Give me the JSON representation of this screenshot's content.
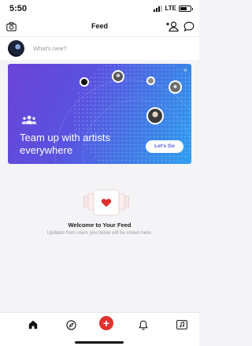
{
  "status_bar": {
    "time": "5:50",
    "network": "LTE",
    "signal_bars": 3,
    "battery_level": 0.65
  },
  "header": {
    "title": "Feed",
    "icons": [
      "camera-icon",
      "add-user-icon",
      "chat-icon"
    ]
  },
  "composer": {
    "placeholder": "What's new?"
  },
  "banner": {
    "title": "Team up with artists everywhere",
    "button_label": "Let's Go",
    "close_label": "×",
    "gradient": [
      "#6a44d8",
      "#2fa0f0"
    ]
  },
  "empty_state": {
    "title": "Welcome to Your Feed",
    "subtitle": "Updates from users you follow will be shown here."
  },
  "tab_bar": {
    "items": [
      "home-icon",
      "explore-icon",
      "create-icon",
      "bell-icon",
      "music-icon"
    ],
    "create_label": "+",
    "accent": "#e0322f"
  }
}
